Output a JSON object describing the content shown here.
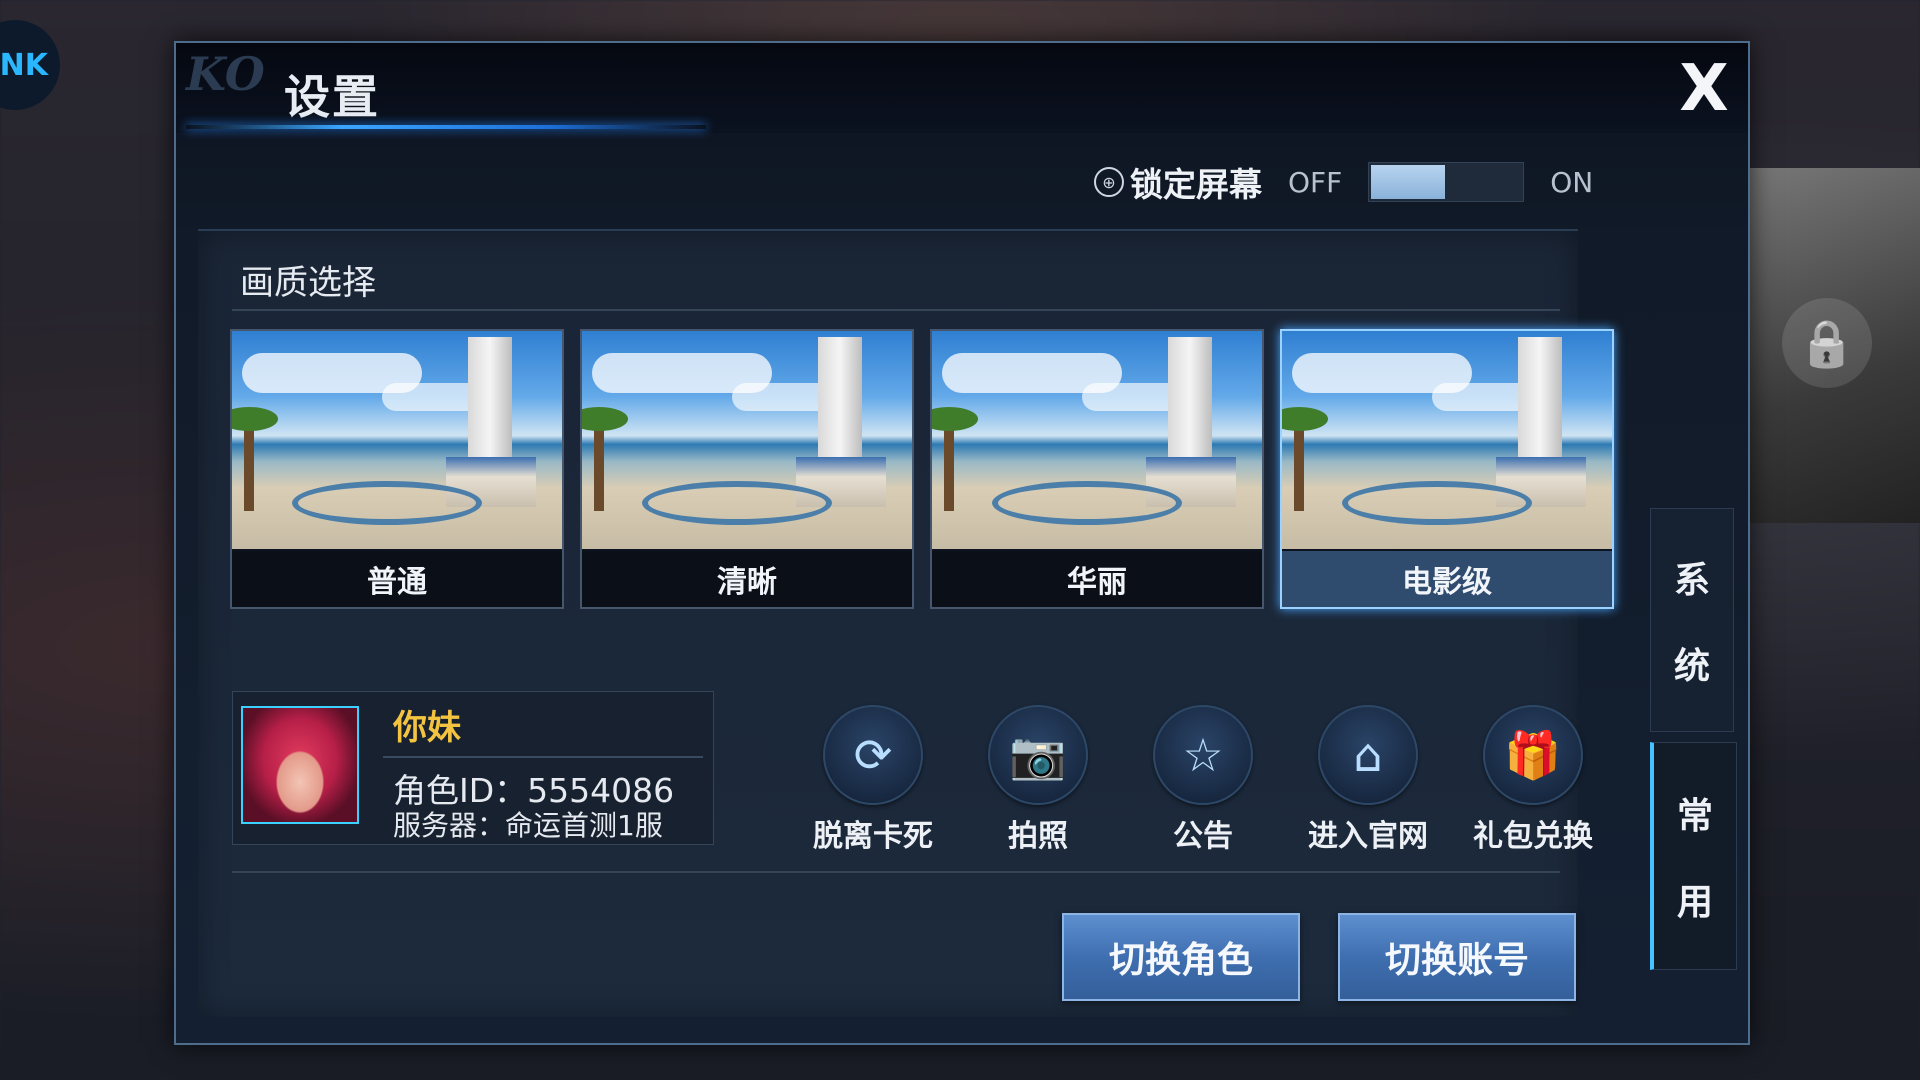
{
  "background": {
    "logo_text": "NK"
  },
  "dialog": {
    "title": "设置",
    "close_label": "X"
  },
  "lock_screen": {
    "label": "锁定屏幕",
    "off": "OFF",
    "on": "ON",
    "value": "off"
  },
  "quality": {
    "title": "画质选择",
    "options": [
      {
        "label": "普通",
        "selected": false
      },
      {
        "label": "清晰",
        "selected": false
      },
      {
        "label": "华丽",
        "selected": false
      },
      {
        "label": "电影级",
        "selected": true
      }
    ]
  },
  "profile": {
    "name": "你妹",
    "role_id": "角色ID：5554086",
    "server": "服务器：命运首测1服"
  },
  "actions": [
    {
      "label": "脱离卡死",
      "icon": "refresh-icon"
    },
    {
      "label": "拍照",
      "icon": "camera-icon"
    },
    {
      "label": "公告",
      "icon": "star-notice-icon"
    },
    {
      "label": "进入官网",
      "icon": "home-icon"
    },
    {
      "label": "礼包兑换",
      "icon": "gift-icon"
    }
  ],
  "buttons": {
    "switch_role": "切换角色",
    "switch_account": "切换账号"
  },
  "side_tabs": [
    {
      "label_1": "系",
      "label_2": "统",
      "active": false
    },
    {
      "label_1": "常",
      "label_2": "用",
      "active": true
    }
  ],
  "colors": {
    "accent": "#47c3ff",
    "name": "#f4c441",
    "button": "#3f6fb0"
  }
}
